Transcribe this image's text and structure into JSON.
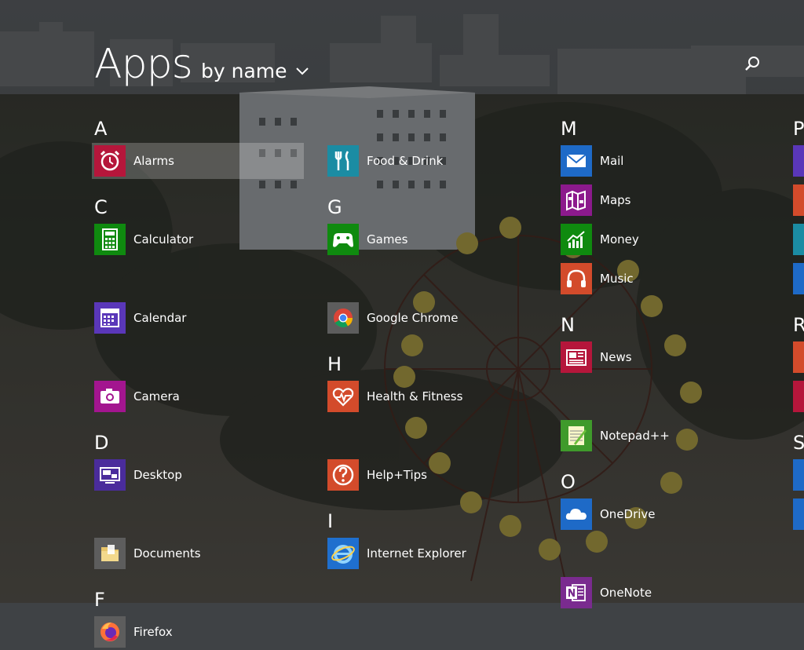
{
  "header": {
    "title": "Apps",
    "sort_label": "by name"
  },
  "columns": [
    {
      "groups": [
        {
          "letter": "A",
          "apps": [
            {
              "name": "Alarms",
              "icon": "alarm-clock-icon",
              "color": "#b5163b",
              "selected": true
            }
          ]
        },
        {
          "letter": "C",
          "apps": [
            {
              "name": "Calculator",
              "icon": "calculator-icon",
              "color": "#0f8a0f"
            },
            {
              "name": "Calendar",
              "icon": "calendar-icon",
              "color": "#5a37b9"
            },
            {
              "name": "Camera",
              "icon": "camera-icon",
              "color": "#a3158f"
            }
          ]
        },
        {
          "letter": "D",
          "apps": [
            {
              "name": "Desktop",
              "icon": "desktop-icon",
              "color": "#4a2c9c"
            },
            {
              "name": "Documents",
              "icon": "folder-icon",
              "color": "#5d5d5d"
            }
          ]
        },
        {
          "letter": "F",
          "apps": [
            {
              "name": "Firefox",
              "icon": "firefox-icon",
              "color": "#5d5d5d"
            }
          ]
        }
      ]
    },
    {
      "groups": [
        {
          "letter": "",
          "apps": [
            {
              "name": "Food & Drink",
              "icon": "fork-knife-icon",
              "color": "#1b8ca3"
            }
          ]
        },
        {
          "letter": "G",
          "apps": [
            {
              "name": "Games",
              "icon": "xbox-controller-icon",
              "color": "#0f8a0f"
            },
            {
              "name": "Google Chrome",
              "icon": "chrome-icon",
              "color": "#5d5d5d"
            }
          ]
        },
        {
          "letter": "H",
          "apps": [
            {
              "name": "Health & Fitness",
              "icon": "heart-pulse-icon",
              "color": "#d34b2b"
            },
            {
              "name": "Help+Tips",
              "icon": "question-icon",
              "color": "#d34b2b"
            }
          ]
        },
        {
          "letter": "I",
          "apps": [
            {
              "name": "Internet Explorer",
              "icon": "internet-explorer-icon",
              "color": "#1f6fce"
            }
          ]
        }
      ]
    },
    {
      "groups": [
        {
          "letter": "M",
          "apps": [
            {
              "name": "Mail",
              "icon": "mail-icon",
              "color": "#1e6ac7"
            },
            {
              "name": "Maps",
              "icon": "map-icon",
              "color": "#8c1a8c"
            },
            {
              "name": "Money",
              "icon": "money-chart-icon",
              "color": "#0f8a0f"
            },
            {
              "name": "Music",
              "icon": "headphones-icon",
              "color": "#d34b2b"
            }
          ]
        },
        {
          "letter": "N",
          "apps": [
            {
              "name": "News",
              "icon": "news-icon",
              "color": "#b5163b"
            },
            {
              "name": "Notepad++",
              "icon": "notepad-plus-icon",
              "color": "#3f9a2b"
            }
          ]
        },
        {
          "letter": "O",
          "apps": [
            {
              "name": "OneDrive",
              "icon": "cloud-icon",
              "color": "#1e6ac7"
            },
            {
              "name": "OneNote",
              "icon": "onenote-icon",
              "color": "#7a2b8f"
            }
          ]
        }
      ]
    }
  ],
  "edge_column": {
    "letters": [
      "P",
      "R",
      "S"
    ],
    "tile_colors": [
      "#5a37b9",
      "#d34b2b",
      "#1b8ca3",
      "#1e6ac7",
      "#d34b2b",
      "#b5163b",
      "#1e6ac7",
      "#1e6ac7"
    ]
  }
}
